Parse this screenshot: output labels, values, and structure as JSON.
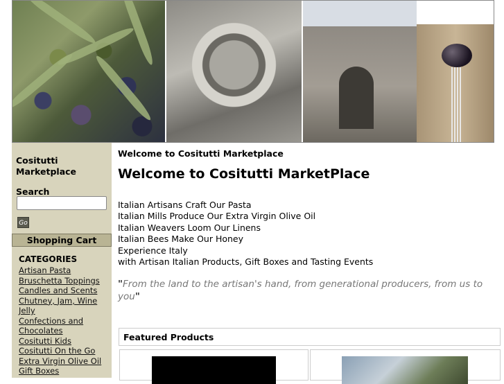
{
  "sidebar": {
    "site_name": "Cositutti Marketplace",
    "search_label": "Search",
    "search_value": "",
    "go_label": "Go",
    "cart_label": "Shopping Cart",
    "categories_heading": "CATEGORIES",
    "categories": [
      "Artisan Pasta",
      "Bruschetta Toppings",
      "Candles and Scents",
      "Chutney, Jam, Wine Jelly",
      "Confections and Chocolates",
      "Cositutti Kids",
      "Cositutti On the Go",
      "Extra Virgin Olive Oil",
      "Gift Boxes"
    ]
  },
  "main": {
    "breadcrumb": "Welcome to Cositutti Marketplace",
    "title": "Welcome to Cositutti MarketPlace",
    "intro_lines": [
      "Italian Artisans Craft Our Pasta",
      "Italian Mills Produce Our Extra Virgin Olive Oil",
      "Italian Weavers Loom Our Linens",
      "Italian Bees Make Our Honey",
      "Experience Italy",
      "with Artisan Italian Products, Gift Boxes and Tasting Events"
    ],
    "quote_open": "\"",
    "quote_text": "From the land to the artisan's hand, from generational producers, from us to you",
    "quote_close": "\"",
    "featured_label": "Featured Products"
  }
}
